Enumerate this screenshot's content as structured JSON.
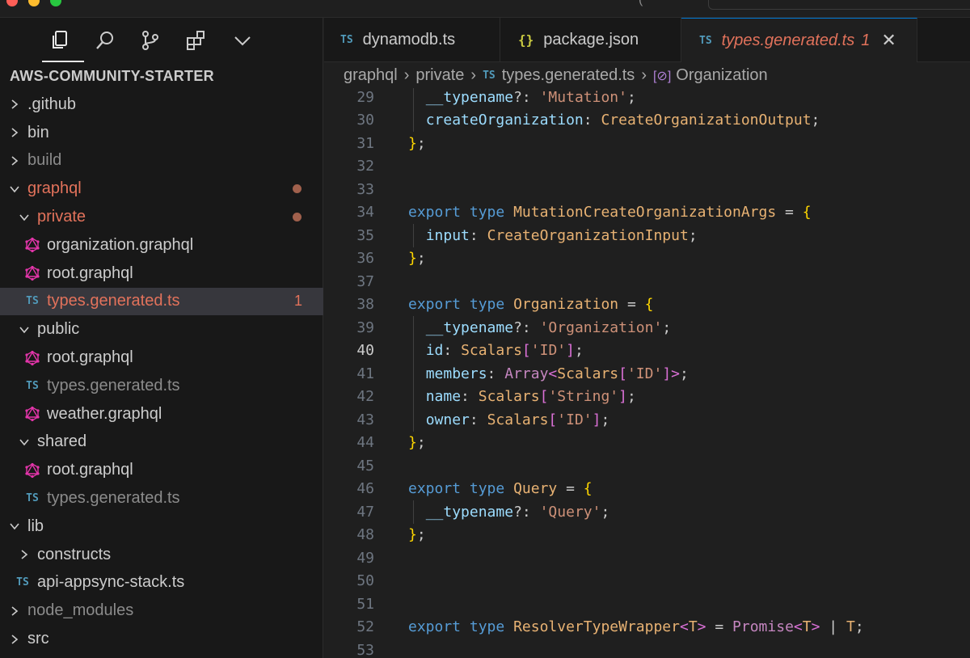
{
  "titlebar": {
    "paren_fragment": "(",
    "search_placeholder": ""
  },
  "activity_bar": {
    "icons": [
      "explorer-icon",
      "search-icon",
      "source-control-icon",
      "extensions-icon",
      "chevron-down-icon"
    ]
  },
  "explorer": {
    "title": "AWS-COMMUNITY-STARTER",
    "items": [
      {
        "label": ".github",
        "kind": "folder",
        "expanded": false
      },
      {
        "label": "bin",
        "kind": "folder",
        "expanded": false
      },
      {
        "label": "build",
        "kind": "folder",
        "expanded": false,
        "dimmed": true
      },
      {
        "label": "graphql",
        "kind": "folder",
        "expanded": true,
        "modified": true
      },
      {
        "label": "private",
        "kind": "folder",
        "expanded": true,
        "modified": true
      },
      {
        "label": "organization.graphql",
        "kind": "graphql"
      },
      {
        "label": "root.graphql",
        "kind": "graphql"
      },
      {
        "label": "types.generated.ts",
        "kind": "ts",
        "badge": "TS",
        "problems": "1",
        "selected": true
      },
      {
        "label": "public",
        "kind": "folder",
        "expanded": true
      },
      {
        "label": "root.graphql",
        "kind": "graphql"
      },
      {
        "label": "types.generated.ts",
        "kind": "ts",
        "badge": "TS",
        "dimmed": true
      },
      {
        "label": "weather.graphql",
        "kind": "graphql"
      },
      {
        "label": "shared",
        "kind": "folder",
        "expanded": true
      },
      {
        "label": "root.graphql",
        "kind": "graphql"
      },
      {
        "label": "types.generated.ts",
        "kind": "ts",
        "badge": "TS",
        "dimmed": true
      },
      {
        "label": "lib",
        "kind": "folder",
        "expanded": true
      },
      {
        "label": "constructs",
        "kind": "folder",
        "expanded": false
      },
      {
        "label": "api-appsync-stack.ts",
        "kind": "ts",
        "badge": "TS"
      },
      {
        "label": "node_modules",
        "kind": "folder",
        "expanded": false,
        "dimmed": true
      },
      {
        "label": "src",
        "kind": "folder",
        "expanded": false
      }
    ]
  },
  "tabs": [
    {
      "badge": "TS",
      "label": "dynamodb.ts"
    },
    {
      "badge": "{}",
      "label": "package.json"
    },
    {
      "badge": "TS",
      "label": "types.generated.ts",
      "problems": "1",
      "active": true
    }
  ],
  "breadcrumb": {
    "parts": [
      "graphql",
      "private",
      "types.generated.ts",
      "Organization"
    ],
    "file_badge": "TS",
    "symbol_icon": "[⊘]"
  },
  "code": {
    "current_line": "40",
    "lines": [
      {
        "n": "29",
        "text": "  __typename?: 'Mutation';"
      },
      {
        "n": "30",
        "text": "  createOrganization: CreateOrganizationOutput;"
      },
      {
        "n": "31",
        "text": "};"
      },
      {
        "n": "32",
        "text": ""
      },
      {
        "n": "33",
        "text": ""
      },
      {
        "n": "34",
        "text": "export type MutationCreateOrganizationArgs = {"
      },
      {
        "n": "35",
        "text": "  input: CreateOrganizationInput;"
      },
      {
        "n": "36",
        "text": "};"
      },
      {
        "n": "37",
        "text": ""
      },
      {
        "n": "38",
        "text": "export type Organization = {"
      },
      {
        "n": "39",
        "text": "  __typename?: 'Organization';"
      },
      {
        "n": "40",
        "text": "  id: Scalars['ID'];"
      },
      {
        "n": "41",
        "text": "  members: Array<Scalars['ID']>;"
      },
      {
        "n": "42",
        "text": "  name: Scalars['String'];"
      },
      {
        "n": "43",
        "text": "  owner: Scalars['ID'];"
      },
      {
        "n": "44",
        "text": "};"
      },
      {
        "n": "45",
        "text": ""
      },
      {
        "n": "46",
        "text": "export type Query = {"
      },
      {
        "n": "47",
        "text": "  __typename?: 'Query';"
      },
      {
        "n": "48",
        "text": "};"
      },
      {
        "n": "49",
        "text": ""
      },
      {
        "n": "50",
        "text": ""
      },
      {
        "n": "51",
        "text": ""
      },
      {
        "n": "52",
        "text": "export type ResolverTypeWrapper<T> = Promise<T> | T;"
      },
      {
        "n": "53",
        "text": ""
      }
    ]
  },
  "colors": {
    "background": "#1f1f1f",
    "sidebar": "#181818",
    "accent": "#0078d4",
    "modified": "#e2725b",
    "graphql_icon": "#e535ab",
    "ts_badge": "#519aba"
  }
}
